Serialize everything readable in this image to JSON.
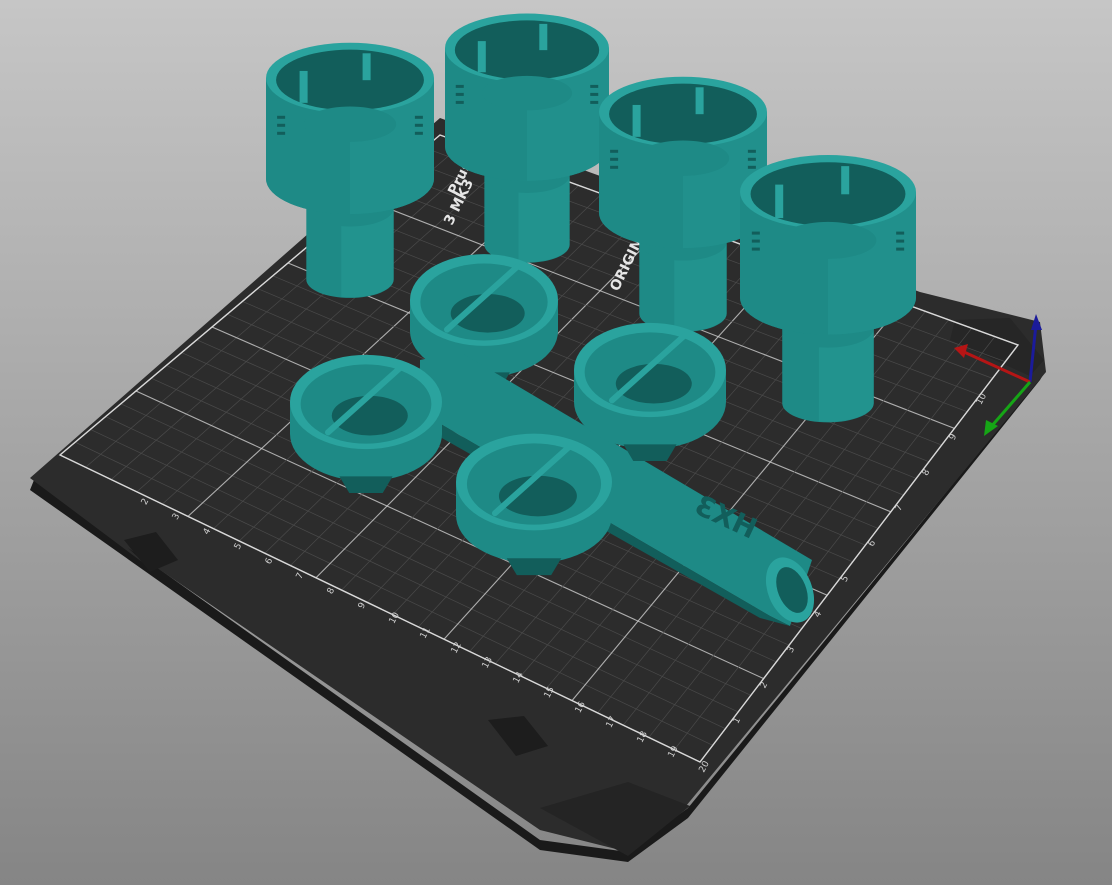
{
  "app": {
    "view": "3D plater viewport"
  },
  "colors": {
    "background_top": "#c4c4c4",
    "background_bottom": "#888888",
    "bed": "#2b2b2b",
    "bed_edge": "#1c1c1c",
    "grid": "#4a4a4a",
    "grid_major": "#cfcfcf",
    "model": "#1e8a86",
    "model_dark": "#125e5b",
    "model_light": "#2aa39e",
    "axis_x": "#c81010",
    "axis_y": "#10b010",
    "axis_z": "#1010a0"
  },
  "bed": {
    "branding": [
      "ORIGINAL",
      "3 MK3",
      "Prus"
    ],
    "tick_labels_front": [
      "2",
      "3",
      "4",
      "5",
      "6",
      "7",
      "8",
      "9",
      "10",
      "11",
      "12",
      "13",
      "14",
      "15",
      "16",
      "17",
      "18",
      "19",
      "20"
    ],
    "tick_labels_side": [
      "1",
      "2",
      "3",
      "4",
      "5",
      "6",
      "7",
      "8",
      "9",
      "10"
    ]
  },
  "objects": {
    "tall_cups": [
      {
        "id": "cup-1"
      },
      {
        "id": "cup-2"
      },
      {
        "id": "cup-3"
      },
      {
        "id": "cup-4"
      }
    ],
    "bowls": [
      {
        "id": "bowl-1"
      },
      {
        "id": "bowl-2"
      },
      {
        "id": "bowl-3"
      },
      {
        "id": "bowl-4"
      }
    ],
    "hex_bar": {
      "id": "hex-bar",
      "embossed_text": "HX3"
    }
  }
}
